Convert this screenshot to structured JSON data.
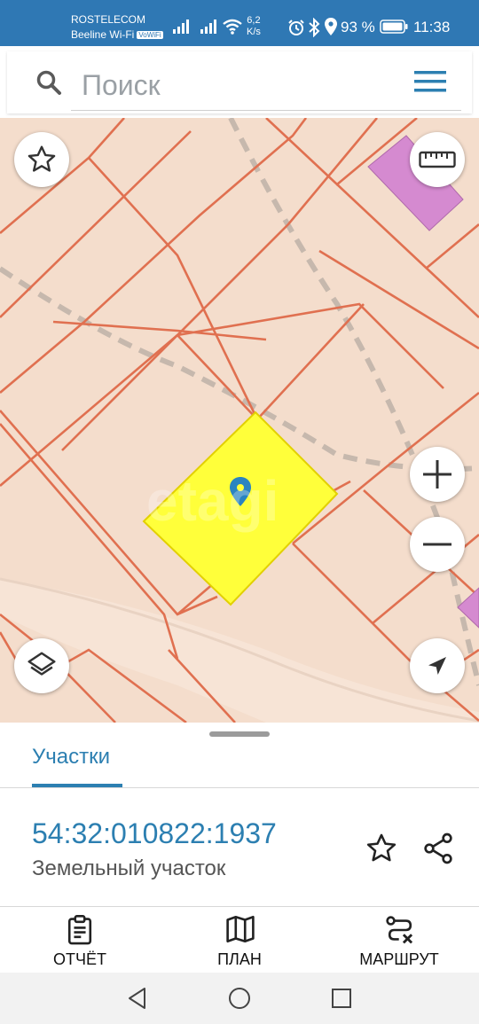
{
  "status_bar": {
    "carrier_line1": "ROSTELECOM",
    "carrier_line2": "Beeline Wi-Fi",
    "volte_badge": "VoWiFi",
    "net_speed_value": "6,2",
    "net_speed_unit": "K/s",
    "battery_percent": "93 %",
    "time": "11:38"
  },
  "search": {
    "placeholder": "Поиск",
    "value": ""
  },
  "map": {
    "watermark": "etagi",
    "colors": {
      "background": "#f4ddcc",
      "parcel_border": "#e07050",
      "selected_parcel": "#ffff3a",
      "building": "#d58ad0",
      "marker": "#2a84c0"
    }
  },
  "sheet": {
    "tab_label": "Участки",
    "parcel_number": "54:32:010822:1937",
    "parcel_type": "Земельный участок"
  },
  "actions": {
    "report_label": "ОТЧЁТ",
    "plan_label": "ПЛАН",
    "route_label": "МАРШРУТ"
  },
  "theme": {
    "status_bar_bg": "#2f78b4",
    "accent": "#2c7fb1"
  }
}
